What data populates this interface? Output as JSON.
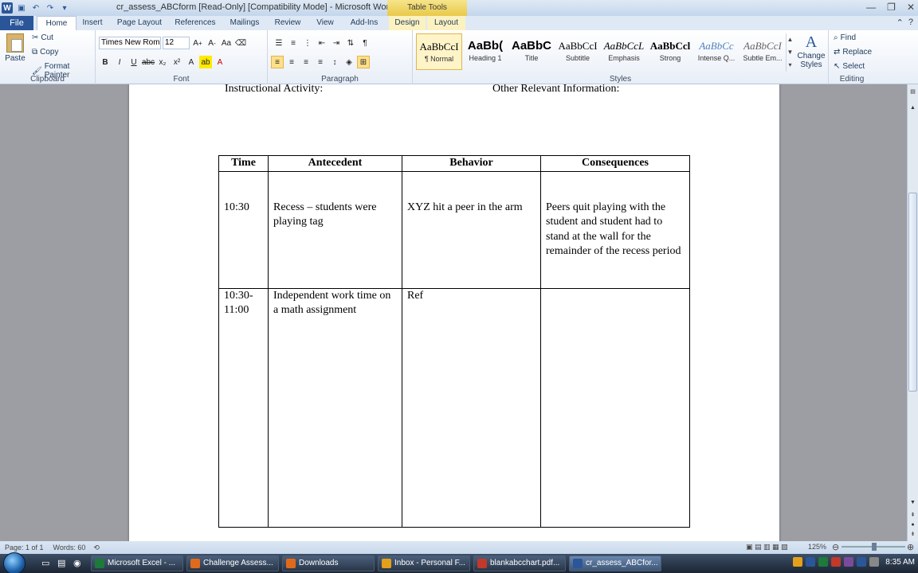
{
  "window": {
    "title": "cr_assess_ABCform [Read-Only] [Compatibility Mode] - Microsoft Word",
    "context_tab_group": "Table Tools"
  },
  "tabs": [
    "File",
    "Home",
    "Insert",
    "Page Layout",
    "References",
    "Mailings",
    "Review",
    "View",
    "Add-Ins",
    "Design",
    "Layout"
  ],
  "ribbon": {
    "clipboard": {
      "paste": "Paste",
      "cut": "Cut",
      "copy": "Copy",
      "format_painter": "Format Painter",
      "label": "Clipboard"
    },
    "font": {
      "name": "Times New Rom",
      "size": "12",
      "label": "Font"
    },
    "paragraph": {
      "label": "Paragraph"
    },
    "styles": {
      "label": "Styles",
      "items": [
        {
          "sample": "AaBbCcI",
          "name": "¶ Normal"
        },
        {
          "sample": "AaBb(",
          "name": "Heading 1"
        },
        {
          "sample": "AaBbC",
          "name": "Title"
        },
        {
          "sample": "AaBbCcI",
          "name": "Subtitle"
        },
        {
          "sample": "AaBbCcL",
          "name": "Emphasis"
        },
        {
          "sample": "AaBbCcl",
          "name": "Strong"
        },
        {
          "sample": "AaBbCc",
          "name": "Intense Q..."
        },
        {
          "sample": "AaBbCcI",
          "name": "Subtle Em..."
        }
      ],
      "change_styles": "Change Styles"
    },
    "editing": {
      "find": "Find",
      "replace": "Replace",
      "select": "Select",
      "label": "Editing"
    }
  },
  "document": {
    "partial_line_left": "Instructional Activity:",
    "partial_line_right": "Other Relevant Information:",
    "table": {
      "headers": [
        "Time",
        "Antecedent",
        "Behavior",
        "Consequences"
      ],
      "rows": [
        {
          "time": "10:30",
          "antecedent": "Recess – students were playing tag",
          "behavior": "XYZ hit a peer in the arm",
          "consequences": "Peers quit playing with the student and student had to stand at the wall for the remainder of the recess period"
        },
        {
          "time": "10:30-11:00",
          "antecedent": "Independent work time on a math assignment",
          "behavior": "Ref",
          "consequences": ""
        }
      ]
    }
  },
  "statusbar": {
    "page": "Page: 1 of 1",
    "words": "Words: 60",
    "zoom": "125%"
  },
  "taskbar": {
    "buttons": [
      {
        "label": "Microsoft Excel - ...",
        "color": "#1d7a3a"
      },
      {
        "label": "Challenge Assess...",
        "color": "#e06a1b"
      },
      {
        "label": "Downloads",
        "color": "#e06a1b"
      },
      {
        "label": "Inbox - Personal F...",
        "color": "#e3a01b"
      },
      {
        "label": "blankabcchart.pdf...",
        "color": "#c0392b"
      },
      {
        "label": "cr_assess_ABCfor...",
        "color": "#2b579a"
      }
    ],
    "clock": "8:35 AM"
  }
}
